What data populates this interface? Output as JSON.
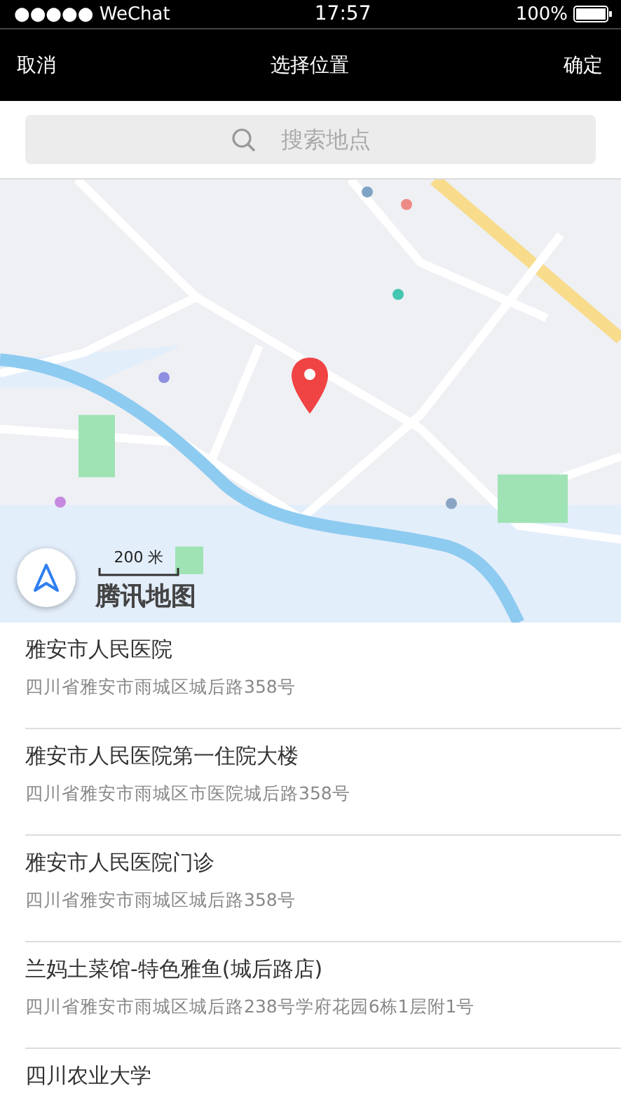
{
  "status_bar": {
    "signal": "●●●●● WeChat",
    "time": "17:57",
    "battery": "100%"
  },
  "nav": {
    "cancel": "取消",
    "title": "选择位置",
    "confirm": "确定"
  },
  "search": {
    "placeholder": "搜索地点"
  },
  "map": {
    "scale": "200 米",
    "logo": "腾讯地图"
  },
  "places": [
    {
      "name": "雅安市人民医院",
      "address": "四川省雅安市雨城区城后路358号"
    },
    {
      "name": "雅安市人民医院第一住院大楼",
      "address": "四川省雅安市雨城区市医院城后路358号"
    },
    {
      "name": "雅安市人民医院门诊",
      "address": "四川省雅安市雨城区城后路358号"
    },
    {
      "name": "兰妈土菜馆-特色雅鱼(城后路店)",
      "address": "四川省雅安市雨城区城后路238号学府花园6栋1层附1号"
    },
    {
      "name": "四川农业大学"
    }
  ]
}
